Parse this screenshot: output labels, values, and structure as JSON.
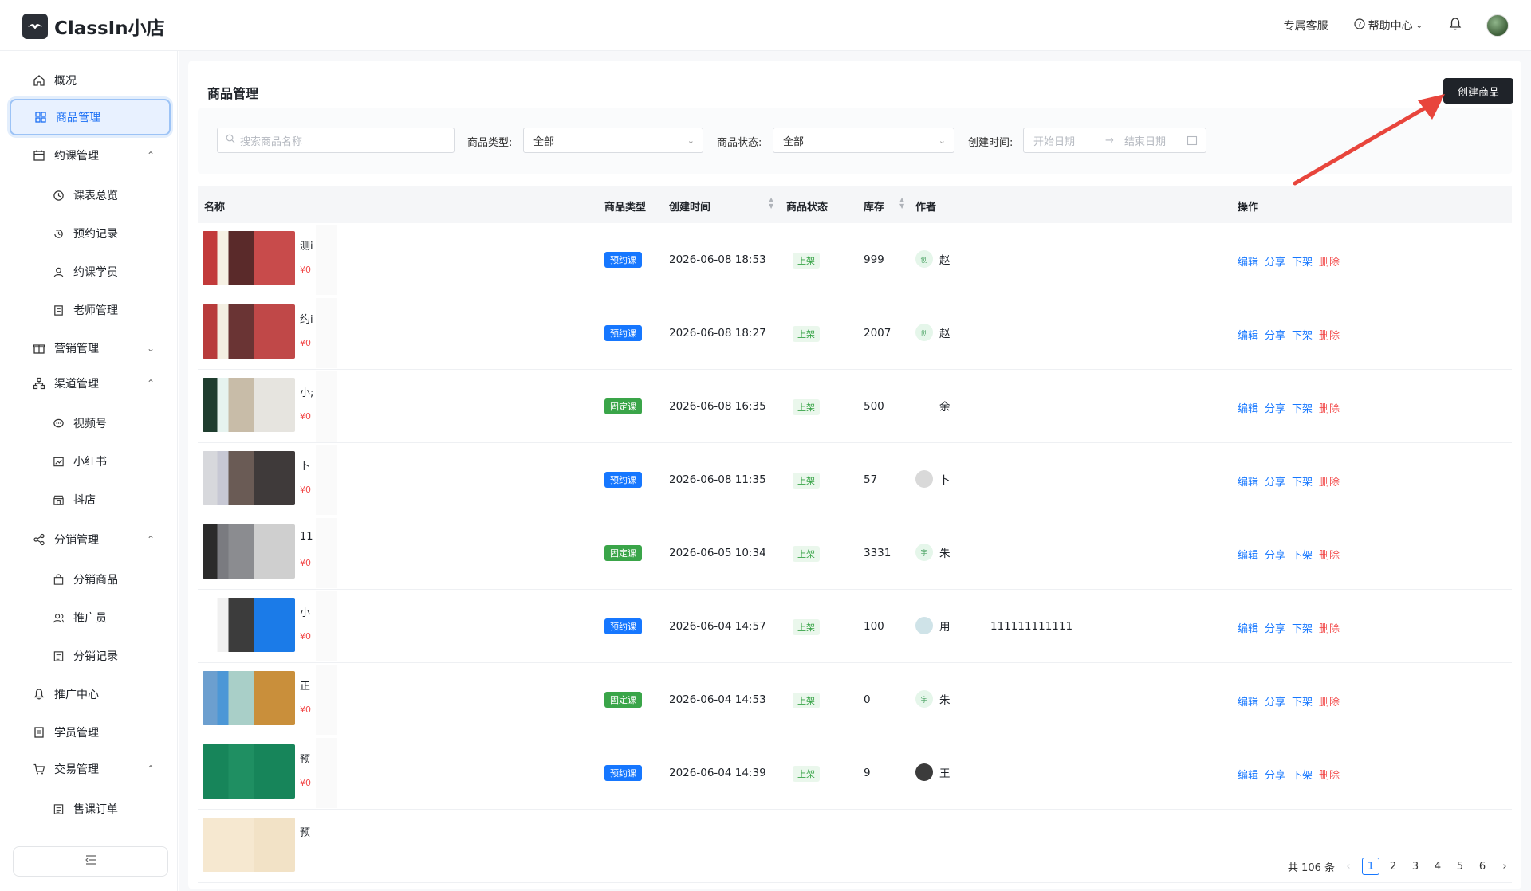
{
  "app": {
    "name": "ClassIn小店",
    "header_links": {
      "support": "专属客服",
      "help": "帮助中心"
    }
  },
  "sidebar": {
    "items": [
      {
        "label": "概况",
        "icon": "home-icon",
        "level": 0
      },
      {
        "label": "商品管理",
        "icon": "grid-icon",
        "level": 0,
        "active": true
      },
      {
        "label": "约课管理",
        "icon": "calendar-icon",
        "level": 0,
        "chevron": "up"
      },
      {
        "label": "课表总览",
        "icon": "clock-icon",
        "level": 1
      },
      {
        "label": "预约记录",
        "icon": "history-icon",
        "level": 1
      },
      {
        "label": "约课学员",
        "icon": "user-icon",
        "level": 1
      },
      {
        "label": "老师管理",
        "icon": "doc-icon",
        "level": 1
      },
      {
        "label": "营销管理",
        "icon": "gift-icon",
        "level": 0,
        "chevron": "down"
      },
      {
        "label": "渠道管理",
        "icon": "sitemap-icon",
        "level": 0,
        "chevron": "up"
      },
      {
        "label": "视频号",
        "icon": "chat-icon",
        "level": 1
      },
      {
        "label": "小红书",
        "icon": "chart-icon",
        "level": 1
      },
      {
        "label": "抖店",
        "icon": "store-icon",
        "level": 1
      },
      {
        "label": "分销管理",
        "icon": "share-icon",
        "level": 0,
        "chevron": "up"
      },
      {
        "label": "分销商品",
        "icon": "bag-icon",
        "level": 1
      },
      {
        "label": "推广员",
        "icon": "users-icon",
        "level": 1
      },
      {
        "label": "分销记录",
        "icon": "list-icon",
        "level": 1
      },
      {
        "label": "推广中心",
        "icon": "bell-icon",
        "level": 0
      },
      {
        "label": "学员管理",
        "icon": "doc-icon",
        "level": 0
      },
      {
        "label": "交易管理",
        "icon": "cart-icon",
        "level": 0,
        "chevron": "up"
      },
      {
        "label": "售课订单",
        "icon": "list-icon",
        "level": 1
      }
    ]
  },
  "page": {
    "title": "商品管理",
    "create_button": "创建商品"
  },
  "filters": {
    "search_placeholder": "搜索商品名称",
    "type_label": "商品类型:",
    "type_value": "全部",
    "status_label": "商品状态:",
    "status_value": "全部",
    "time_label": "创建时间:",
    "start_placeholder": "开始日期",
    "end_placeholder": "结束日期"
  },
  "table": {
    "columns": {
      "name": "名称",
      "type": "商品类型",
      "created": "创建时间",
      "status": "商品状态",
      "stock": "库存",
      "author": "作者",
      "actions": "操作"
    },
    "actions": {
      "edit": "编辑",
      "share": "分享",
      "offline": "下架",
      "delete": "删除"
    },
    "rows": [
      {
        "name": "测i",
        "price": "¥0",
        "type": "预约课",
        "type_color": "blue",
        "created": "2026-06-08 18:53",
        "status": "上架",
        "stock": "999",
        "author": "赵",
        "author_badge": "创",
        "extra": ""
      },
      {
        "name": "约i",
        "price": "¥0",
        "type": "预约课",
        "type_color": "blue",
        "created": "2026-06-08 18:27",
        "status": "上架",
        "stock": "2007",
        "author": "赵",
        "author_badge": "创",
        "extra": ""
      },
      {
        "name": "小;",
        "price": "¥0",
        "type": "固定课",
        "type_color": "green",
        "created": "2026-06-08 16:35",
        "status": "上架",
        "stock": "500",
        "author": "余",
        "author_badge": "",
        "extra": ""
      },
      {
        "name": "卜",
        "price": "¥0",
        "type": "预约课",
        "type_color": "blue",
        "created": "2026-06-08 11:35",
        "status": "上架",
        "stock": "57",
        "author": "卜",
        "author_badge": "",
        "extra": ""
      },
      {
        "name": "11",
        "price": "¥0",
        "type": "固定课",
        "type_color": "green",
        "created": "2026-06-05 10:34",
        "status": "上架",
        "stock": "3331",
        "author": "朱",
        "author_badge": "宇",
        "extra": ""
      },
      {
        "name": "小",
        "price": "¥0",
        "type": "预约课",
        "type_color": "blue",
        "created": "2026-06-04 14:57",
        "status": "上架",
        "stock": "100",
        "author": "用",
        "author_badge": "",
        "extra": "111111111111"
      },
      {
        "name": "正",
        "price": "¥0",
        "type": "固定课",
        "type_color": "green",
        "created": "2026-06-04 14:53",
        "status": "上架",
        "stock": "0",
        "author": "朱",
        "author_badge": "宇",
        "extra": ""
      },
      {
        "name": "预",
        "price": "¥0",
        "type": "预约课",
        "type_color": "blue",
        "created": "2026-06-04 14:39",
        "status": "上架",
        "stock": "9",
        "author": "王",
        "author_badge": "",
        "extra": ""
      },
      {
        "name": "预",
        "price": "",
        "type": "",
        "type_color": "blue",
        "created": "",
        "status": "",
        "stock": "",
        "author": "",
        "author_badge": "",
        "extra": ""
      }
    ]
  },
  "pagination": {
    "total": "共 106 条",
    "pages": [
      "1",
      "2",
      "3",
      "4",
      "5",
      "6"
    ],
    "current": "1"
  },
  "colors": {
    "primary": "#1677ff",
    "danger": "#f24b4b",
    "success": "#3aa549",
    "dark_button": "#1f2329",
    "arrow": "#e8453c"
  }
}
